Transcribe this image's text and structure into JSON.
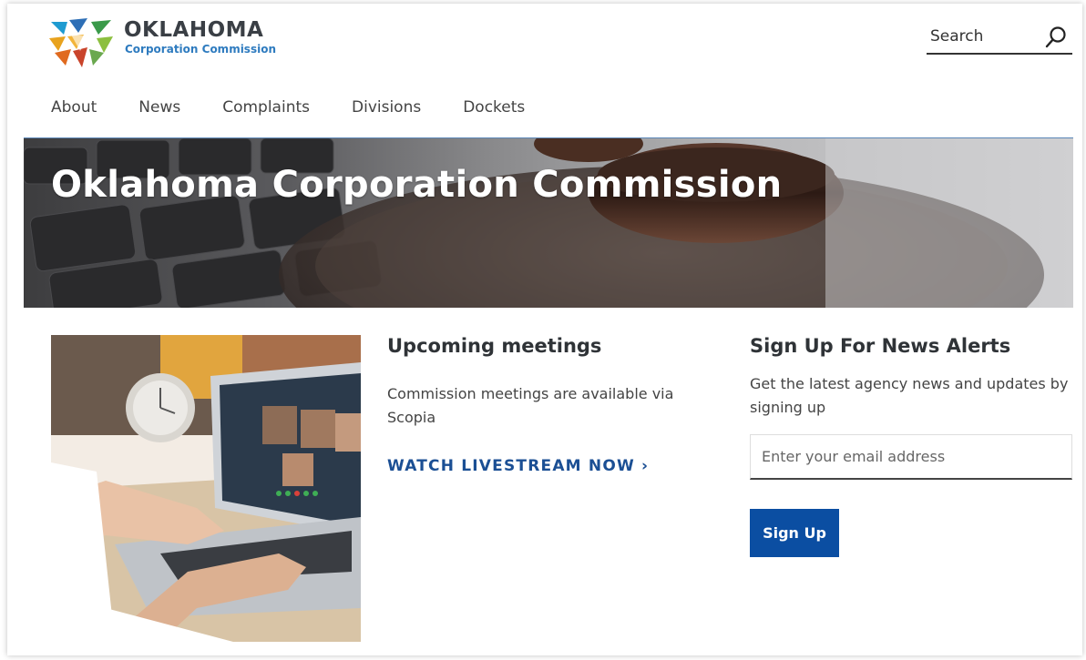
{
  "header": {
    "logo_title": "OKLAHOMA",
    "logo_subtitle": "Corporation Commission",
    "search_placeholder": "Search"
  },
  "nav": {
    "items": [
      {
        "label": "About"
      },
      {
        "label": "News"
      },
      {
        "label": "Complaints"
      },
      {
        "label": "Divisions"
      },
      {
        "label": "Dockets"
      }
    ]
  },
  "hero": {
    "title": "Oklahoma Corporation Commission"
  },
  "meetings": {
    "heading": "Upcoming meetings",
    "body": "Commission meetings are available via Scopia",
    "link_label": "WATCH LIVESTREAM NOW ›"
  },
  "alerts": {
    "heading": "Sign Up For News Alerts",
    "body": "Get the latest agency news and updates by signing up",
    "email_placeholder": "Enter your email address",
    "button_label": "Sign Up"
  },
  "colors": {
    "accent_blue": "#0b4ea2",
    "link_blue": "#1b4f94",
    "logo_blue": "#2e7bbf"
  }
}
